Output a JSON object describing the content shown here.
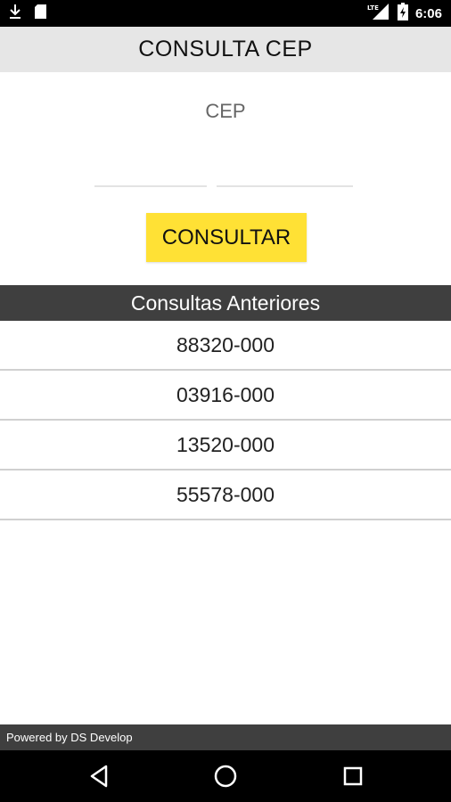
{
  "status_bar": {
    "time": "6:06",
    "network": "LTE",
    "icons": [
      "download-icon",
      "sd-card-icon",
      "lte-signal-icon",
      "battery-icon"
    ]
  },
  "app": {
    "title": "CONSULTA CEP"
  },
  "form": {
    "cep_label": "CEP",
    "cep_part1_value": "",
    "cep_part2_value": "",
    "consult_button": "CONSULTAR"
  },
  "history": {
    "header": "Consultas Anteriores",
    "items": [
      "88320-000",
      "03916-000",
      "13520-000",
      "55578-000"
    ]
  },
  "footer": {
    "text": "Powered by DS Develop"
  },
  "nav": {
    "icons": [
      "back-icon",
      "home-icon",
      "recents-icon"
    ]
  },
  "colors": {
    "accent": "#ffe135",
    "app_bar": "#e6e6e6",
    "dark_header": "#3f3f3f"
  }
}
